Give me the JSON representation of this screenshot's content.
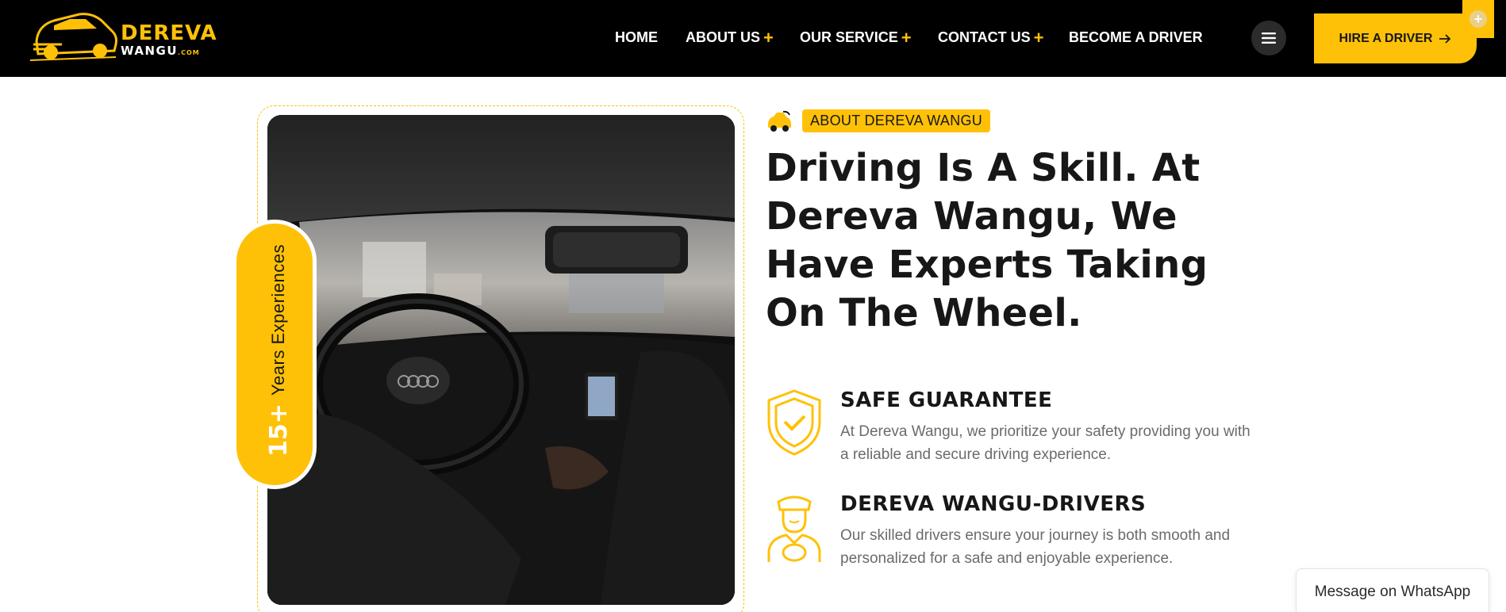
{
  "colors": {
    "accent": "#ffc107",
    "header_bg": "#000000",
    "text": "#171717",
    "muted": "#6b6b6b"
  },
  "logo": {
    "line1": "DEREVA",
    "line2": "WANGU",
    "suffix": ".COM"
  },
  "nav": {
    "items": [
      {
        "label": "HOME",
        "has_plus": false
      },
      {
        "label": "ABOUT US",
        "has_plus": true
      },
      {
        "label": "OUR SERVICE",
        "has_plus": true
      },
      {
        "label": "CONTACT US",
        "has_plus": true
      },
      {
        "label": "BECOME A DRIVER",
        "has_plus": false
      }
    ],
    "plus_symbol": "+",
    "menu_icon": "hamburger-icon",
    "hire_button": {
      "label": "HIRE A DRIVER",
      "icon": "arrow-right-icon"
    },
    "corner_button": "+"
  },
  "about": {
    "tag": "ABOUT DEREVA WANGU",
    "tag_icon": "car-icon",
    "headline": "Driving Is A Skill. At Dereva Wangu, We Have Experts Taking On The Wheel.",
    "experience": {
      "number": "15+",
      "label": "Years Experiences"
    },
    "photo_alt": "driver-interior-photo",
    "features": [
      {
        "icon": "shield-check-icon",
        "title": "SAFE GUARANTEE",
        "text": "At Dereva Wangu, we prioritize your safety providing you with a reliable and secure driving experience."
      },
      {
        "icon": "driver-icon",
        "title": "DEREVA WANGU-DRIVERS",
        "text": "Our skilled drivers ensure your journey is both smooth and personalized for a safe and enjoyable experience."
      }
    ]
  },
  "whatsapp": {
    "label": "Message on WhatsApp"
  }
}
